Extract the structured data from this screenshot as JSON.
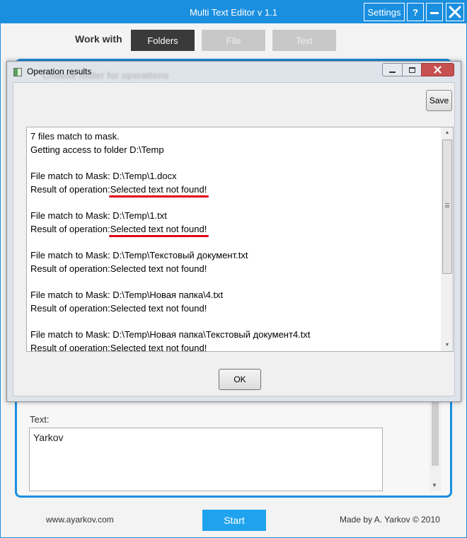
{
  "app": {
    "title": "Multi Text Editor v 1.1",
    "settings_label": "Settings",
    "help_label": "?",
    "close_glyph": "✕",
    "work_with_label": "Work with",
    "modes": [
      "Folders",
      "File",
      "Text"
    ],
    "active_mode": "Folders",
    "blurred_background_text": "Choose folder for operations",
    "text_label": "Text:",
    "text_value": "Yarkov",
    "site_link": "www.ayarkov.com",
    "start_label": "Start",
    "credit": "Made by A. Yarkov © 2010",
    "accent_color": "#1a8fe0"
  },
  "dialog": {
    "title": "Operation results",
    "close_glyph": "✕",
    "save_label": "Save",
    "ok_label": "OK",
    "lines": {
      "l1": "7 files match to mask.",
      "l2": "Getting access to folder D:\\Temp",
      "l3": "File match to Mask: D:\\Temp\\1.docx",
      "l4_prefix": "Result of operation:",
      "l4_value": "Selected text not found!",
      "l5": "File match to Mask: D:\\Temp\\1.txt",
      "l6_prefix": "Result of operation:",
      "l6_value": "Selected text not found!",
      "l7": "File match to Mask: D:\\Temp\\Текстовый документ.txt",
      "l8": "Result of operation:Selected text not found!",
      "l9": "File match to Mask: D:\\Temp\\Новая папка\\4.txt",
      "l10": "Result of operation:Selected text not found!",
      "l11": "File match to Mask: D:\\Temp\\Новая папка\\Текстовый документ4.txt",
      "l12": "Result of operation:Selected text not found!"
    },
    "highlight_color": "#e0001a"
  },
  "icons": {
    "close": "close-icon",
    "minimize": "minimize-icon",
    "maximize": "maximize-icon",
    "scroll_up": "▲",
    "scroll_down": "▼"
  }
}
